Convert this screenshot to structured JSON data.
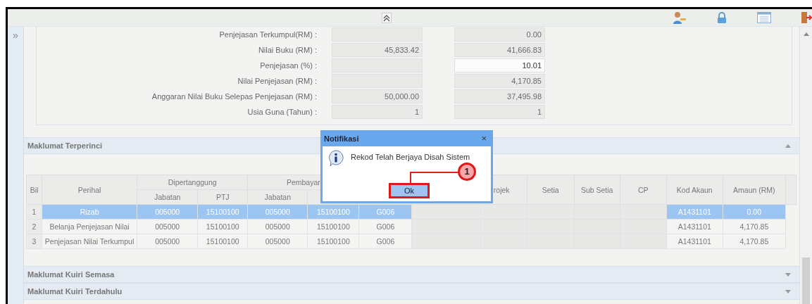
{
  "sidebar": {
    "toggle": "»"
  },
  "form": {
    "rows": [
      {
        "label": "Penjejasan Terkumpul(RM) :",
        "fields": [
          {
            "editable": false
          },
          {
            "value": "0.00",
            "editable": false
          }
        ]
      },
      {
        "label": "Nilai Buku (RM) :",
        "fields": [
          {
            "value": "45,833.42",
            "editable": false
          },
          {
            "value": "41,666.83",
            "editable": false
          }
        ]
      },
      {
        "label": "Penjejasan (%) :",
        "fields": [
          {
            "editable": false
          },
          {
            "value": "10.01",
            "editable": true
          }
        ]
      },
      {
        "label": "Nilai Penjejasan (RM) :",
        "fields": [
          {
            "editable": false
          },
          {
            "value": "4,170.85",
            "editable": false
          }
        ]
      },
      {
        "label": "Anggaran Nilai Buku Selepas Penjejasan (RM) :",
        "fields": [
          {
            "value": "50,000.00",
            "editable": false
          },
          {
            "value": "37,495.98",
            "editable": false
          }
        ]
      },
      {
        "label": "Usia Guna (Tahun) :",
        "fields": [
          {
            "value": "1",
            "editable": false
          },
          {
            "value": "1",
            "editable": false
          }
        ]
      }
    ]
  },
  "sections": [
    {
      "title": "Maklumat Terperinci",
      "expanded": true
    },
    {
      "title": "Maklumat Kuiri Semasa",
      "expanded": false
    },
    {
      "title": "Maklumat Kuiri Terdahulu",
      "expanded": false
    }
  ],
  "table": {
    "bil": "Bil",
    "perihal": "Perihal",
    "groups": [
      {
        "label": "Dipertanggung",
        "columns": [
          "Jabatan",
          "PTJ"
        ]
      },
      {
        "label": "Pembayar",
        "columns": [
          "Jabatan"
        ]
      }
    ],
    "columns_right": [
      "rojek",
      "Setia",
      "Sub Setia",
      "CP",
      "Kod Akaun",
      "Amaun (RM)"
    ],
    "rows": [
      {
        "selected": true,
        "bil": "1",
        "perihal": "Rizab",
        "dp_jabatan": "005000",
        "dp_ptj": "15100100",
        "pb_jabatan": "005000",
        "pb_ptj": "15100100",
        "column_7": "G006",
        "kod_akaun": "A1431101",
        "amaun": "0.00"
      },
      {
        "selected": false,
        "bil": "2",
        "perihal": "Belanja Penjejasan Nilai",
        "dp_jabatan": "005000",
        "dp_ptj": "15100100",
        "pb_jabatan": "005000",
        "pb_ptj": "15100100",
        "column_7": "G006",
        "kod_akaun": "A1431101",
        "amaun": "4,170.85"
      },
      {
        "selected": false,
        "bil": "3",
        "perihal": "Penjejasan Nilai Terkumpul",
        "dp_jabatan": "005000",
        "dp_ptj": "15100100",
        "pb_jabatan": "005000",
        "pb_ptj": "15100100",
        "column_7": "G006",
        "kod_akaun": "A1431101",
        "amaun": "4,170.85"
      }
    ]
  },
  "dialog": {
    "title": "Notifikasi",
    "close": "×",
    "message": "Rekod Telah Berjaya Disah Sistem",
    "button": "Ok",
    "step": "1"
  }
}
